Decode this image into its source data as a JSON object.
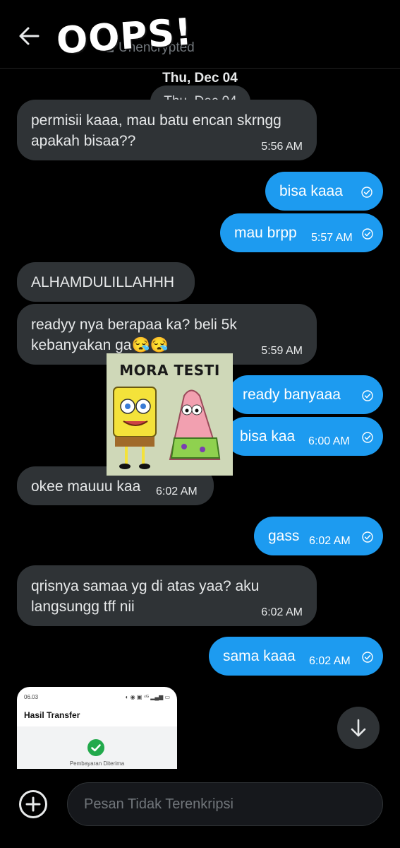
{
  "header": {
    "sticker_title": "OOPS!",
    "subtitle": "Unencrypted"
  },
  "date_heading": "Thu, Dec 04",
  "date_pill": "Thu, Dec 04",
  "messages": [
    {
      "dir": "in",
      "line1": "permisii kaaa, mau batu encan skrngg",
      "line2": "apakah bisaa??",
      "time": "5:56 AM"
    },
    {
      "dir": "out",
      "text": "bisa kaaa",
      "time": ""
    },
    {
      "dir": "out",
      "text": "mau brpp",
      "time": "5:57 AM"
    },
    {
      "dir": "in",
      "text": "ALHAMDULILLAHHH",
      "time": ""
    },
    {
      "dir": "in",
      "line1": "readyy nya berapaa ka? beli 5k",
      "line2": "kebanyakan ga😪😪",
      "time": "5:59 AM"
    },
    {
      "dir": "out",
      "text": "ready banyaaa",
      "time": ""
    },
    {
      "dir": "out",
      "text": "bisa kaa",
      "time": "6:00 AM"
    },
    {
      "dir": "in",
      "text": "okee mauuu kaa",
      "time": "6:02 AM"
    },
    {
      "dir": "out",
      "text": "gass",
      "time": "6:02 AM"
    },
    {
      "dir": "in",
      "line1": "qrisnya samaa yg di atas yaa? aku",
      "line2": "langsungg tff nii",
      "time": "6:02 AM"
    },
    {
      "dir": "out",
      "text": "sama kaaa",
      "time": "6:02 AM"
    }
  ],
  "sticker": {
    "text": "MORA TESTI"
  },
  "attachment": {
    "status_time": "06.03",
    "status_icons": "◐ ◉ ▣ ⁴ᴳ ▂▄▆ ▭",
    "title": "Hasil Transfer",
    "label": "Pembayaran Diterima"
  },
  "composer": {
    "placeholder": "Pesan Tidak Terenkripsi"
  },
  "colors": {
    "incoming": "#2f3336",
    "outgoing": "#1d9bf0",
    "background": "#000000"
  },
  "icons": [
    "back-arrow-icon",
    "lock-icon",
    "check-icon",
    "scroll-down-icon",
    "plus-icon"
  ]
}
